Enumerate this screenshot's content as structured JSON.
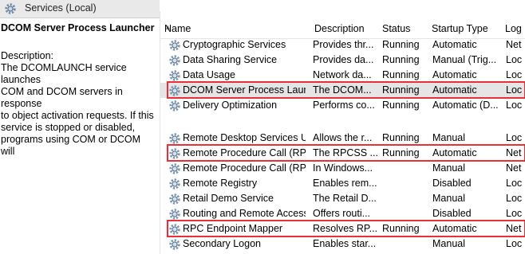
{
  "window": {
    "title": "Services (Local)"
  },
  "description_pane": {
    "service_name": "DCOM Server Process Launcher",
    "label": "Description:",
    "text_lines": [
      "The DCOMLAUNCH service launches",
      "COM and DCOM servers in response",
      "to object activation requests. If this",
      "service is stopped or disabled,",
      "programs using COM or DCOM will"
    ]
  },
  "table": {
    "headers": {
      "name": "Name",
      "description": "Description",
      "status": "Status",
      "startup_type": "Startup Type",
      "log_on_as": "Log"
    },
    "group1": [
      {
        "name": "Cryptographic Services",
        "description": "Provides thr...",
        "status": "Running",
        "startup_type": "Automatic",
        "log_on_as": "Net"
      },
      {
        "name": "Data Sharing Service",
        "description": "Provides da...",
        "status": "Running",
        "startup_type": "Manual (Trig...",
        "log_on_as": "Loc"
      },
      {
        "name": "Data Usage",
        "description": "Network da...",
        "status": "Running",
        "startup_type": "Automatic",
        "log_on_as": "Loc"
      },
      {
        "name": "DCOM Server Process Laun...",
        "description": "The DCOM...",
        "status": "Running",
        "startup_type": "Automatic",
        "log_on_as": "Loc"
      },
      {
        "name": "Delivery Optimization",
        "description": "Performs co...",
        "status": "Running",
        "startup_type": "Automatic (D...",
        "log_on_as": "Loc"
      }
    ],
    "group2": [
      {
        "name": "Remote Desktop Services U...",
        "description": "Allows the r...",
        "status": "Running",
        "startup_type": "Manual",
        "log_on_as": "Loc"
      },
      {
        "name": "Remote Procedure Call (RPC)",
        "description": "The RPCSS ...",
        "status": "Running",
        "startup_type": "Automatic",
        "log_on_as": "Net"
      },
      {
        "name": "Remote Procedure Call (RP...",
        "description": "In Windows...",
        "status": "",
        "startup_type": "Manual",
        "log_on_as": "Net"
      },
      {
        "name": "Remote Registry",
        "description": "Enables rem...",
        "status": "",
        "startup_type": "Disabled",
        "log_on_as": "Loc"
      },
      {
        "name": "Retail Demo Service",
        "description": "The Retail D...",
        "status": "",
        "startup_type": "Manual",
        "log_on_as": "Loc"
      },
      {
        "name": "Routing and Remote Access",
        "description": "Offers routi...",
        "status": "",
        "startup_type": "Disabled",
        "log_on_as": "Loc"
      },
      {
        "name": "RPC Endpoint Mapper",
        "description": "Resolves RP...",
        "status": "Running",
        "startup_type": "Automatic",
        "log_on_as": "Net"
      },
      {
        "name": "Secondary Logon",
        "description": "Enables star...",
        "status": "",
        "startup_type": "Manual",
        "log_on_as": "Loc"
      }
    ]
  },
  "colors": {
    "highlight": "#e8303a",
    "selected_row": "#e5e5e5",
    "header_bg": "#e9e9e9"
  },
  "icons": {
    "title": "gear-icon",
    "row": "service-gear-icon"
  }
}
